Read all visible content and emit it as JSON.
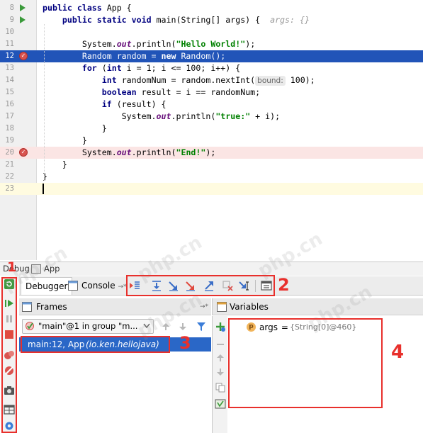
{
  "editor": {
    "lines": [
      {
        "n": "8",
        "parts": [
          [
            "kw",
            "public class "
          ],
          [
            "t",
            "App {"
          ]
        ]
      },
      {
        "n": "9",
        "parts": [
          [
            "t",
            "    "
          ],
          [
            "kw",
            "public static void "
          ],
          [
            "t",
            "main(String[] args) {  "
          ],
          [
            "hint",
            "args: {}"
          ]
        ]
      },
      {
        "n": "10",
        "parts": []
      },
      {
        "n": "11",
        "parts": [
          [
            "t",
            "        System."
          ],
          [
            "fld",
            "out"
          ],
          [
            "t",
            ".println("
          ],
          [
            "str",
            "\"Hello World!\""
          ],
          [
            "t",
            ");"
          ]
        ]
      },
      {
        "n": "12",
        "parts": [
          [
            "t",
            "        Random random = "
          ],
          [
            "kw",
            "new "
          ],
          [
            "t",
            "Random();"
          ]
        ]
      },
      {
        "n": "13",
        "parts": [
          [
            "t",
            "        "
          ],
          [
            "kw",
            "for "
          ],
          [
            "t",
            "("
          ],
          [
            "kw",
            "int "
          ],
          [
            "t",
            "i = 1; i <= 100; i++) {"
          ]
        ]
      },
      {
        "n": "14",
        "parts": [
          [
            "t",
            "            "
          ],
          [
            "kw",
            "int "
          ],
          [
            "t",
            "randomNum = random.nextInt("
          ],
          [
            "ph",
            "bound:"
          ],
          [
            "t",
            " 100);"
          ]
        ]
      },
      {
        "n": "15",
        "parts": [
          [
            "t",
            "            "
          ],
          [
            "kw",
            "boolean "
          ],
          [
            "t",
            "result = i == randomNum;"
          ]
        ]
      },
      {
        "n": "16",
        "parts": [
          [
            "t",
            "            "
          ],
          [
            "kw",
            "if "
          ],
          [
            "t",
            "(result) {"
          ]
        ]
      },
      {
        "n": "17",
        "parts": [
          [
            "t",
            "                System."
          ],
          [
            "fld",
            "out"
          ],
          [
            "t",
            ".println("
          ],
          [
            "str",
            "\"true:\""
          ],
          [
            "t",
            " + i);"
          ]
        ]
      },
      {
        "n": "18",
        "parts": [
          [
            "t",
            "            }"
          ]
        ]
      },
      {
        "n": "19",
        "parts": [
          [
            "t",
            "        }"
          ]
        ]
      },
      {
        "n": "20",
        "parts": [
          [
            "t",
            "        System."
          ],
          [
            "fld",
            "out"
          ],
          [
            "t",
            ".println("
          ],
          [
            "str",
            "\"End!\""
          ],
          [
            "t",
            ");"
          ]
        ]
      },
      {
        "n": "21",
        "parts": [
          [
            "t",
            "    }"
          ]
        ]
      },
      {
        "n": "22",
        "parts": [
          [
            "t",
            "}"
          ]
        ]
      },
      {
        "n": "23",
        "parts": []
      }
    ]
  },
  "debug": {
    "window_label": "Debug",
    "config_name": "App",
    "tabs": {
      "debugger": "Debugger",
      "console": "Console",
      "console_suffix": "→*"
    },
    "frames": {
      "title": "Frames",
      "pin": "→*",
      "thread": "\"main\"@1 in group \"m...",
      "frame_method": "main:12, App",
      "frame_package": "(io.ken.hellojava)"
    },
    "variables": {
      "title": "Variables",
      "var_name": "args",
      "var_eq": " = ",
      "var_value": "{String[0]@460}",
      "type_badge": "p"
    }
  },
  "annotations": {
    "n1": "1",
    "n2": "2",
    "n3": "3",
    "n4": "4"
  },
  "watermark": "php.cn",
  "colors": {
    "selection": "#2154b8",
    "breakpoint_line": "#fbe5e4",
    "frame_selected": "#2a67c7",
    "annotation": "#e8302c",
    "keyword": "#000080",
    "string": "#008000"
  }
}
